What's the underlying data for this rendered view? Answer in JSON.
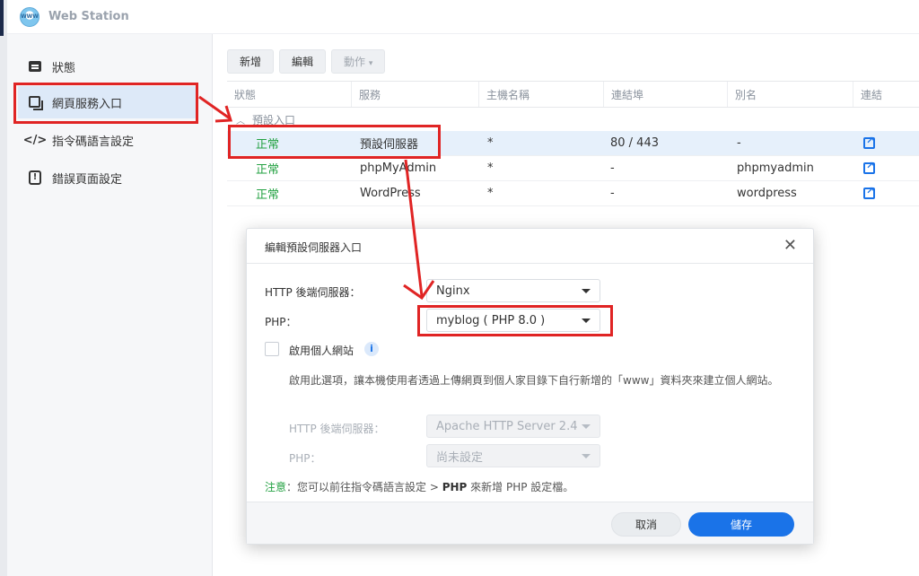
{
  "app": {
    "title": "Web Station",
    "logo_text": "WWW"
  },
  "sidebar": {
    "items": [
      {
        "label": "狀態",
        "icon": "status-icon"
      },
      {
        "label": "網頁服務入口",
        "icon": "portal-icon",
        "active": true
      },
      {
        "label": "指令碼語言設定",
        "icon": "code-icon"
      },
      {
        "label": "錯誤頁面設定",
        "icon": "error-page-icon"
      }
    ]
  },
  "toolbar": {
    "add": "新增",
    "edit": "編輯",
    "action": "動作"
  },
  "table": {
    "headers": [
      "狀態",
      "服務",
      "主機名稱",
      "連結埠",
      "別名",
      "連結"
    ],
    "group": "預設入口",
    "rows": [
      {
        "status": "正常",
        "service": "預設伺服器",
        "host": "*",
        "port": "80 / 443",
        "alias": "-"
      },
      {
        "status": "正常",
        "service": "phpMyAdmin",
        "host": "*",
        "port": "-",
        "alias": "phpmyadmin"
      },
      {
        "status": "正常",
        "service": "WordPress",
        "host": "*",
        "port": "-",
        "alias": "wordpress"
      }
    ]
  },
  "modal": {
    "title": "編輯預設伺服器入口",
    "http_label": "HTTP 後端伺服器：",
    "http_value": "Nginx",
    "php_label": "PHP：",
    "php_value": "myblog ( PHP 8.0 )",
    "personal_label": "啟用個人網站",
    "description": "啟用此選項，讓本機使用者透過上傳網頁到個人家目錄下自行新增的「www」資料夾來建立個人網站。",
    "sub_http_label": "HTTP 後端伺服器：",
    "sub_http_value": "Apache HTTP Server 2.4",
    "sub_php_label": "PHP：",
    "sub_php_value": "尚未設定",
    "note_prefix": "注意",
    "note_text": "：您可以前往指令碼語言設定 > ",
    "note_bold": "PHP",
    "note_suffix": " 來新增 PHP 設定檔。",
    "cancel": "取消",
    "save": "儲存"
  },
  "colors": {
    "accent": "#1a73e8",
    "ok": "#23a142",
    "annotation": "#e02424"
  }
}
